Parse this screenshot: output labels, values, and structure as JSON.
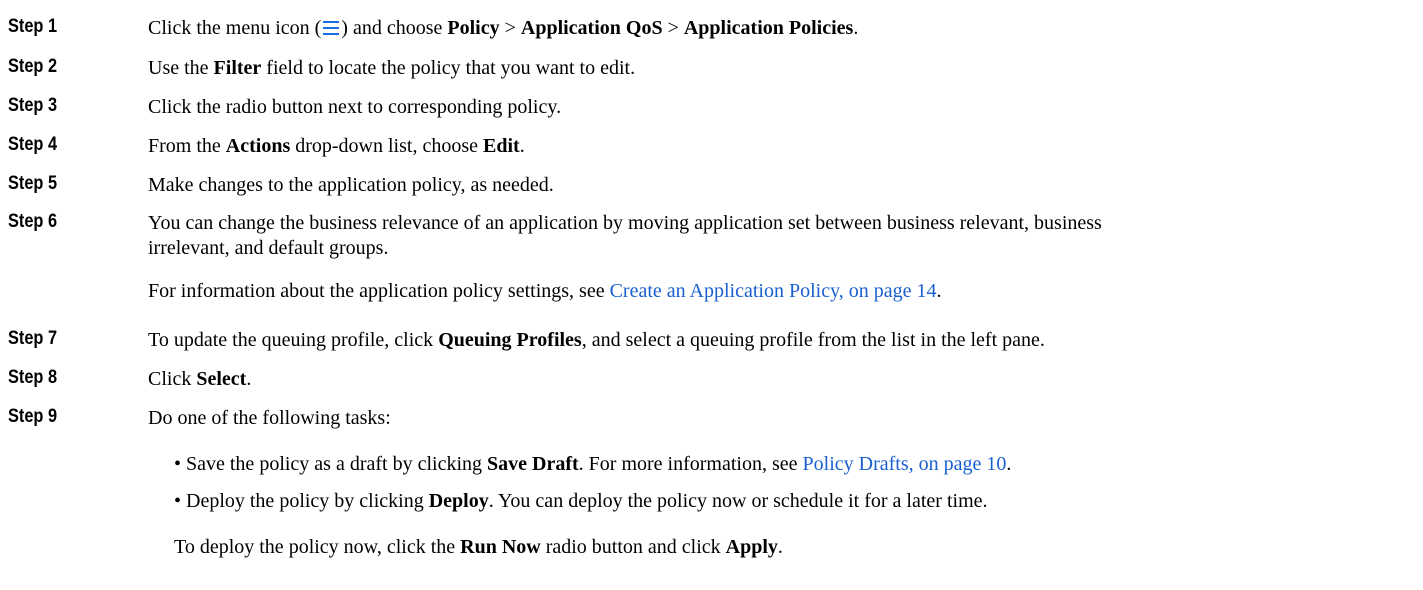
{
  "steps": [
    {
      "label": "Step 1",
      "pre": "Click the menu icon (",
      "post": ") and choose ",
      "b1": "Policy",
      "sep1": " > ",
      "b2": "Application QoS",
      "sep2": " > ",
      "b3": "Application Policies",
      "end": "."
    },
    {
      "label": "Step 2",
      "pre": "Use the ",
      "b1": "Filter",
      "post": " field to locate the policy that you want to edit."
    },
    {
      "label": "Step 3",
      "text": "Click the radio button next to corresponding policy."
    },
    {
      "label": "Step 4",
      "pre": "From the ",
      "b1": "Actions",
      "mid": " drop-down list, choose ",
      "b2": "Edit",
      "end": "."
    },
    {
      "label": "Step 5",
      "text": "Make changes to the application policy, as needed."
    },
    {
      "label": "Step 6",
      "line1": "You can change the business relevance of an application by moving application set between business relevant, business",
      "line2": "irrelevant, and default groups.",
      "note_pre": "For information about the application policy settings, see ",
      "note_link": "Create an Application Policy, on page 14",
      "note_end": "."
    },
    {
      "label": "Step 7",
      "pre": "To update the queuing profile, click ",
      "b1": "Queuing Profiles",
      "post": ", and select a queuing profile from the list in the left pane."
    },
    {
      "label": "Step 8",
      "pre": "Click ",
      "b1": "Select",
      "end": "."
    },
    {
      "label": "Step 9",
      "text": "Do one of the following tasks:"
    }
  ],
  "bullets": [
    {
      "pre": "• Save the policy as a draft by clicking ",
      "b1": "Save Draft",
      "mid": ". For more information, see ",
      "link": "Policy Drafts, on page 10",
      "end": "."
    },
    {
      "pre": "• Deploy the policy by clicking ",
      "b1": "Deploy",
      "post": ". You can deploy the policy now or schedule it for a later time."
    }
  ],
  "final": {
    "pre": "To deploy the policy now, click the ",
    "b1": "Run Now",
    "mid": " radio button and click ",
    "b2": "Apply",
    "end": "."
  },
  "icons": {
    "menu": "menu-icon"
  },
  "colors": {
    "link": "#1a5fd0",
    "icon": "#1a6fe0"
  }
}
